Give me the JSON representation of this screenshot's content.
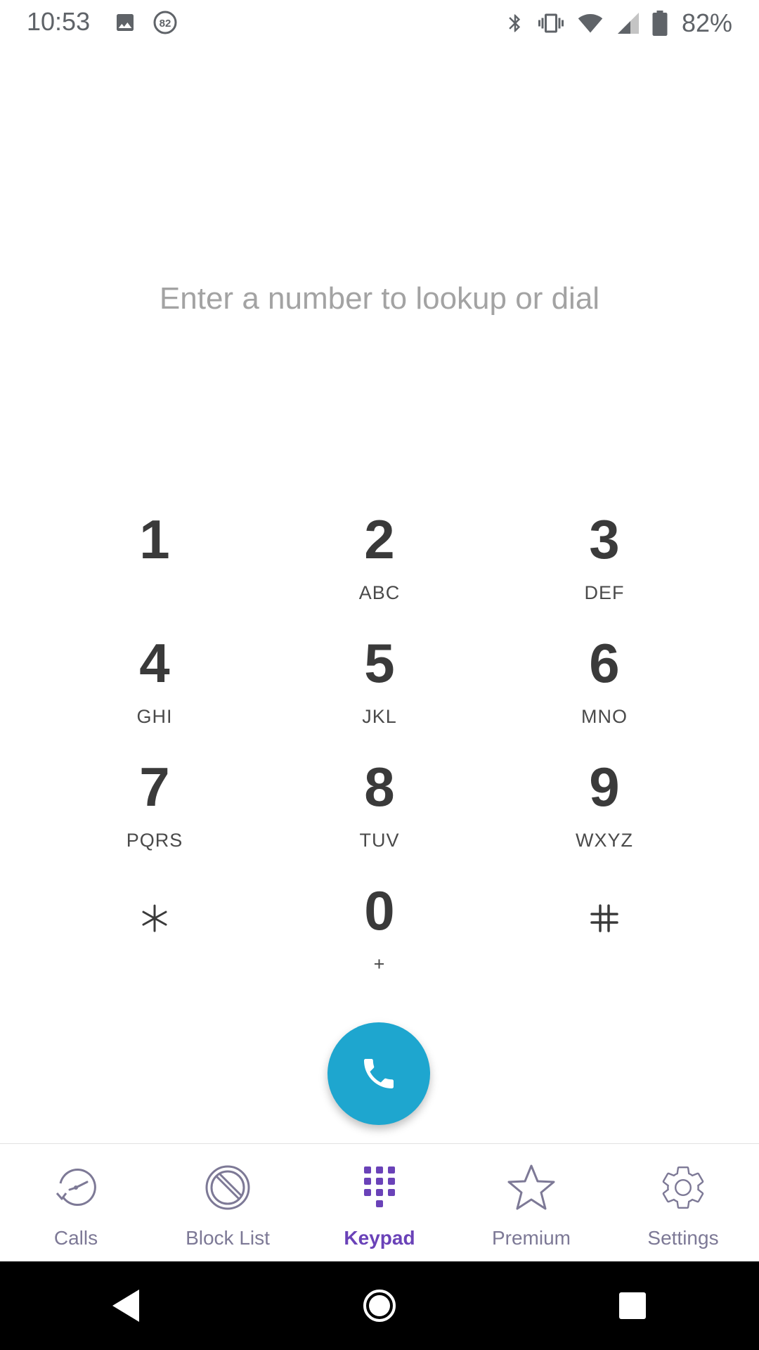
{
  "status_bar": {
    "time": "10:53",
    "notification_badge": "82",
    "battery_percent": "82%",
    "icons": [
      "gallery-icon",
      "badge-icon",
      "bluetooth-icon",
      "vibrate-icon",
      "wifi-icon",
      "cell-signal-icon",
      "battery-icon"
    ]
  },
  "dialer": {
    "hint": "Enter a number to lookup or dial"
  },
  "keypad": {
    "keys": [
      {
        "digit": "1",
        "letters": ""
      },
      {
        "digit": "2",
        "letters": "ABC"
      },
      {
        "digit": "3",
        "letters": "DEF"
      },
      {
        "digit": "4",
        "letters": "GHI"
      },
      {
        "digit": "5",
        "letters": "JKL"
      },
      {
        "digit": "6",
        "letters": "MNO"
      },
      {
        "digit": "7",
        "letters": "PQRS"
      },
      {
        "digit": "8",
        "letters": "TUV"
      },
      {
        "digit": "9",
        "letters": "WXYZ"
      },
      {
        "digit": "*",
        "letters": ""
      },
      {
        "digit": "0",
        "letters": "+"
      },
      {
        "digit": "#",
        "letters": ""
      }
    ]
  },
  "call_button": {
    "icon": "phone-icon",
    "color": "#1ea6cf"
  },
  "bottom_nav": {
    "items": [
      {
        "label": "Calls",
        "icon": "clock-history-icon",
        "active": false
      },
      {
        "label": "Block List",
        "icon": "block-icon",
        "active": false
      },
      {
        "label": "Keypad",
        "icon": "keypad-icon",
        "active": true
      },
      {
        "label": "Premium",
        "icon": "star-icon",
        "active": false
      },
      {
        "label": "Settings",
        "icon": "gear-icon",
        "active": false
      }
    ],
    "active_color": "#6a42b8",
    "inactive_color": "#7d7996"
  },
  "android_nav": {
    "icons": [
      "back-icon",
      "home-icon",
      "recents-icon"
    ]
  }
}
